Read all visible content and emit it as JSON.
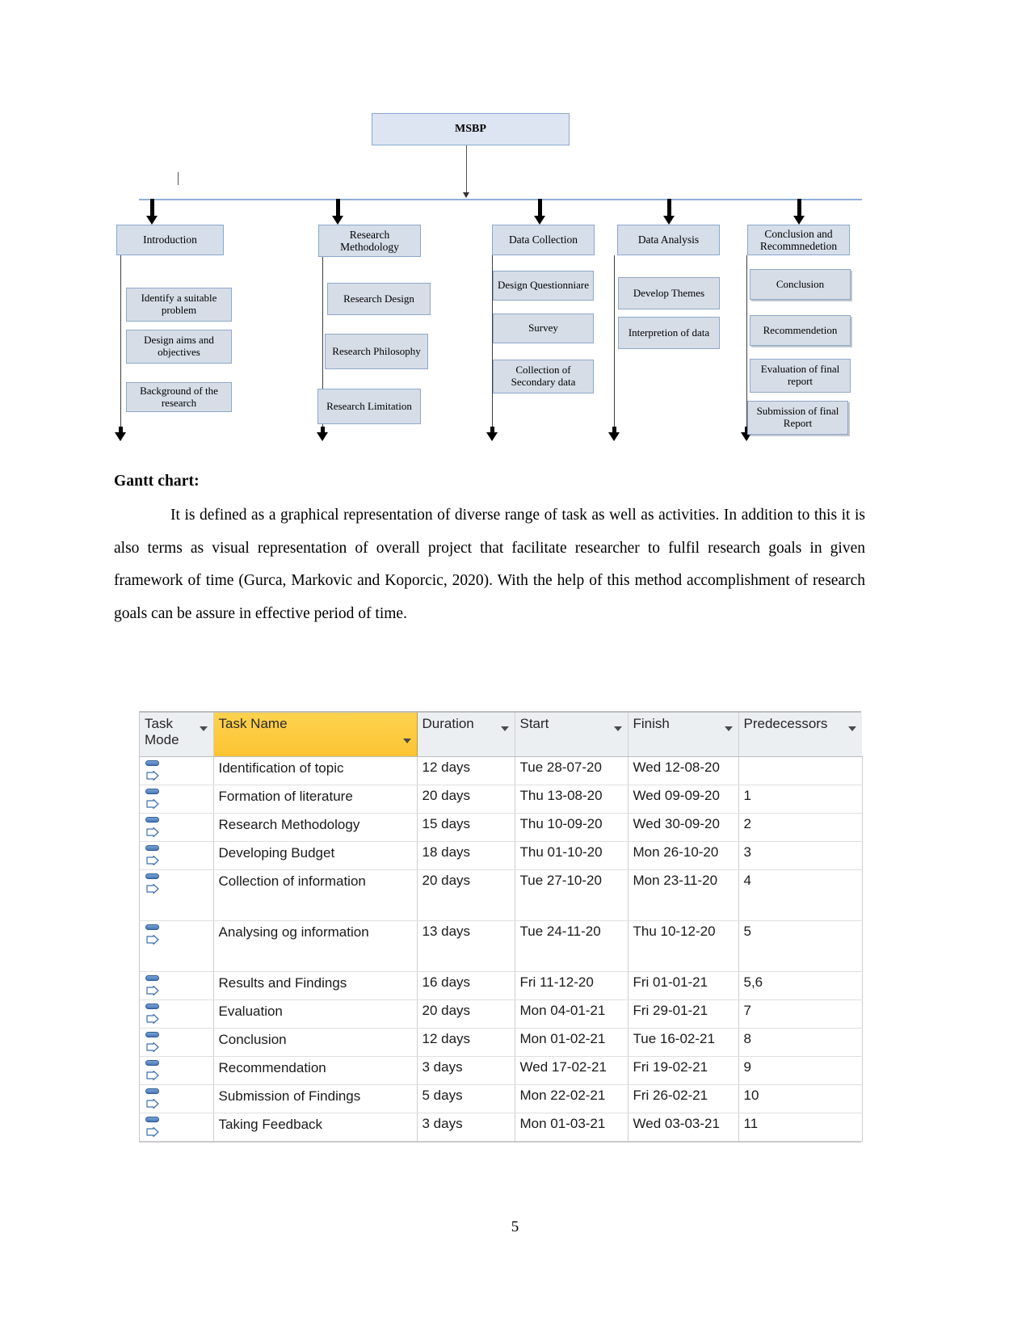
{
  "diagram": {
    "root": {
      "label": "MSBP"
    },
    "branches": [
      {
        "title": "Introduction",
        "children": [
          {
            "label": "Identify a suitable problem"
          },
          {
            "label": "Design aims and objectives"
          },
          {
            "label": "Background of the research"
          }
        ]
      },
      {
        "title": "Research Methodology",
        "children": [
          {
            "label": "Research Design"
          },
          {
            "label": "Research Philosophy"
          },
          {
            "label": "Research Limitation"
          }
        ]
      },
      {
        "title": "Data Collection",
        "children": [
          {
            "label": "Design Questionniare"
          },
          {
            "label": "Survey"
          },
          {
            "label": "Collection of Secondary data"
          }
        ]
      },
      {
        "title": "Data Analysis",
        "children": [
          {
            "label": "Develop Themes"
          },
          {
            "label": "Interpretion of data"
          }
        ]
      },
      {
        "title": "Conclusion and Recommnedetion",
        "children": [
          {
            "label": "Conclusion"
          },
          {
            "label": "Recommendetion"
          },
          {
            "label": "Evaluation of final report"
          },
          {
            "label": "Submission of final Report"
          }
        ]
      }
    ]
  },
  "content": {
    "heading": "Gantt chart:",
    "paragraph": "It is defined as a graphical representation of diverse range of task as well as activities. In addition to this it is also terms as visual representation of overall project that facilitate researcher to fulfil research goals in given framework of time (Gurca, Markovic and Koporcic, 2020). With the help of this method accomplishment of research goals can be assure in effective period of time."
  },
  "gantt": {
    "columns": [
      {
        "key": "mode",
        "label": "Task Mode",
        "highlighted": false
      },
      {
        "key": "name",
        "label": "Task Name",
        "highlighted": true
      },
      {
        "key": "duration",
        "label": "Duration",
        "highlighted": false
      },
      {
        "key": "start",
        "label": "Start",
        "highlighted": false
      },
      {
        "key": "finish",
        "label": "Finish",
        "highlighted": false
      },
      {
        "key": "predecessors",
        "label": "Predecessors",
        "highlighted": false
      }
    ],
    "accent_highlight_color": "#fcc847",
    "header_background_color": "#eceff2",
    "row_icon": "task-mode-manual-icon",
    "rows": [
      {
        "mode_icon": "task-mode-manual-icon",
        "name": "Identification of topic",
        "duration": "12 days",
        "start": "Tue 28-07-20",
        "finish": "Wed 12-08-20",
        "predecessors": ""
      },
      {
        "mode_icon": "task-mode-manual-icon",
        "name": "Formation of literature",
        "duration": "20 days",
        "start": "Thu 13-08-20",
        "finish": "Wed 09-09-20",
        "predecessors": "1"
      },
      {
        "mode_icon": "task-mode-manual-icon",
        "name": "Research Methodology",
        "duration": "15 days",
        "start": "Thu 10-09-20",
        "finish": "Wed 30-09-20",
        "predecessors": "2"
      },
      {
        "mode_icon": "task-mode-manual-icon",
        "name": "Developing Budget",
        "duration": "18 days",
        "start": "Thu 01-10-20",
        "finish": "Mon 26-10-20",
        "predecessors": "3"
      },
      {
        "mode_icon": "task-mode-manual-icon",
        "name": "Collection of information",
        "duration": "20 days",
        "start": "Tue 27-10-20",
        "finish": "Mon 23-11-20",
        "predecessors": "4",
        "tall": true
      },
      {
        "mode_icon": "task-mode-manual-icon",
        "name": "Analysing og information",
        "duration": "13 days",
        "start": "Tue 24-11-20",
        "finish": "Thu 10-12-20",
        "predecessors": "5",
        "tall": true
      },
      {
        "mode_icon": "task-mode-manual-icon",
        "name": "Results and Findings",
        "duration": "16 days",
        "start": "Fri 11-12-20",
        "finish": "Fri 01-01-21",
        "predecessors": "5,6"
      },
      {
        "mode_icon": "task-mode-manual-icon",
        "name": "Evaluation",
        "duration": "20 days",
        "start": "Mon 04-01-21",
        "finish": "Fri 29-01-21",
        "predecessors": "7"
      },
      {
        "mode_icon": "task-mode-manual-icon",
        "name": "Conclusion",
        "duration": "12 days",
        "start": "Mon 01-02-21",
        "finish": "Tue 16-02-21",
        "predecessors": "8"
      },
      {
        "mode_icon": "task-mode-manual-icon",
        "name": "Recommendation",
        "duration": "3 days",
        "start": "Wed 17-02-21",
        "finish": "Fri 19-02-21",
        "predecessors": "9"
      },
      {
        "mode_icon": "task-mode-manual-icon",
        "name": "Submission of Findings",
        "duration": "5 days",
        "start": "Mon 22-02-21",
        "finish": "Fri 26-02-21",
        "predecessors": "10"
      },
      {
        "mode_icon": "task-mode-manual-icon",
        "name": "Taking Feedback",
        "duration": "3 days",
        "start": "Mon 01-03-21",
        "finish": "Wed 03-03-21",
        "predecessors": "11"
      }
    ]
  },
  "footer": {
    "page_number": "5"
  }
}
